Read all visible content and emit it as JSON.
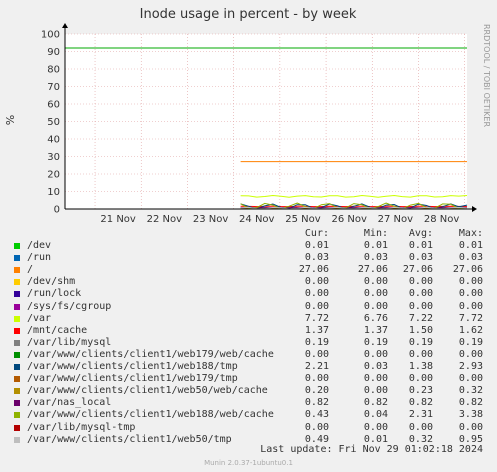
{
  "chart_data": {
    "type": "line",
    "title": "Inode usage in percent - by week",
    "ylabel": "%",
    "side_text": "RRDTOOL / TOBI OETIKER",
    "ylim": [
      0,
      100
    ],
    "yticks": [
      0,
      10,
      20,
      30,
      40,
      50,
      60,
      70,
      80,
      90,
      100
    ],
    "xticks": [
      "21 Nov",
      "22 Nov",
      "23 Nov",
      "24 Nov",
      "25 Nov",
      "26 Nov",
      "27 Nov",
      "28 Nov"
    ],
    "xrange_days": [
      20.35,
      29.05
    ],
    "columns": [
      "Cur:",
      "Min:",
      "Avg:",
      "Max:"
    ],
    "series": [
      {
        "name": "/dev",
        "color": "#00cc00",
        "cur": "0.01",
        "min": "0.01",
        "avg": "0.01",
        "max": "0.01",
        "start": 20.35,
        "level": 0.01
      },
      {
        "name": "/run",
        "color": "#0066b3",
        "cur": "0.03",
        "min": "0.03",
        "avg": "0.03",
        "max": "0.03",
        "start": 24.15,
        "level": 0.03
      },
      {
        "name": "/",
        "color": "#ff8000",
        "cur": "27.06",
        "min": "27.06",
        "avg": "27.06",
        "max": "27.06",
        "start": 24.15,
        "level": 27.06
      },
      {
        "name": "/dev/shm",
        "color": "#ffcc00",
        "cur": "0.00",
        "min": "0.00",
        "avg": "0.00",
        "max": "0.00",
        "start": 24.15,
        "level": 0.0
      },
      {
        "name": "/run/lock",
        "color": "#330099",
        "cur": "0.00",
        "min": "0.00",
        "avg": "0.00",
        "max": "0.00",
        "start": 24.15,
        "level": 0.0
      },
      {
        "name": "/sys/fs/cgroup",
        "color": "#990099",
        "cur": "0.00",
        "min": "0.00",
        "avg": "0.00",
        "max": "0.00",
        "start": 24.15,
        "level": 0.0
      },
      {
        "name": "/var",
        "color": "#ccff00",
        "cur": "7.72",
        "min": "6.76",
        "avg": "7.22",
        "max": "7.72",
        "start": 24.15,
        "level": 7.22
      },
      {
        "name": "/mnt/cache",
        "color": "#ff0000",
        "cur": "1.37",
        "min": "1.37",
        "avg": "1.50",
        "max": "1.62",
        "start": 24.15,
        "level": 1.5
      },
      {
        "name": "/var/lib/mysql",
        "color": "#808080",
        "cur": "0.19",
        "min": "0.19",
        "avg": "0.19",
        "max": "0.19",
        "start": 24.15,
        "level": 0.19
      },
      {
        "name": "/var/www/clients/client1/web179/web/cache",
        "color": "#008f00",
        "cur": "0.00",
        "min": "0.00",
        "avg": "0.00",
        "max": "0.00",
        "start": 24.15,
        "level": 0.0
      },
      {
        "name": "/var/www/clients/client1/web188/tmp",
        "color": "#00487d",
        "cur": "2.21",
        "min": "0.03",
        "avg": "1.38",
        "max": "2.93",
        "start": 24.15,
        "level": 1.38
      },
      {
        "name": "/var/www/clients/client1/web179/tmp",
        "color": "#b35a00",
        "cur": "0.00",
        "min": "0.00",
        "avg": "0.00",
        "max": "0.00",
        "start": 24.15,
        "level": 0.0
      },
      {
        "name": "/var/www/clients/client1/web50/web/cache",
        "color": "#b38f00",
        "cur": "0.20",
        "min": "0.00",
        "avg": "0.23",
        "max": "0.32",
        "start": 24.15,
        "level": 0.23
      },
      {
        "name": "/var/nas_local",
        "color": "#6b006b",
        "cur": "0.82",
        "min": "0.82",
        "avg": "0.82",
        "max": "0.82",
        "start": 24.15,
        "level": 0.82
      },
      {
        "name": "/var/www/clients/client1/web188/web/cache",
        "color": "#8fb300",
        "cur": "0.43",
        "min": "0.04",
        "avg": "2.31",
        "max": "3.38",
        "start": 24.15,
        "level": 2.31
      },
      {
        "name": "/var/lib/mysql-tmp",
        "color": "#b30000",
        "cur": "0.00",
        "min": "0.00",
        "avg": "0.00",
        "max": "0.00",
        "start": 24.15,
        "level": 0.0
      },
      {
        "name": "/var/www/clients/client1/web50/tmp",
        "color": "#bebebe",
        "cur": "0.49",
        "min": "0.01",
        "avg": "0.32",
        "max": "0.95",
        "start": 24.15,
        "level": 0.32
      }
    ],
    "warning_line": {
      "value": 92,
      "color": "#00aa00"
    },
    "last_update": "Last update: Fri Nov 29 01:02:18 2024",
    "version": "Munin 2.0.37-1ubuntu0.1"
  }
}
